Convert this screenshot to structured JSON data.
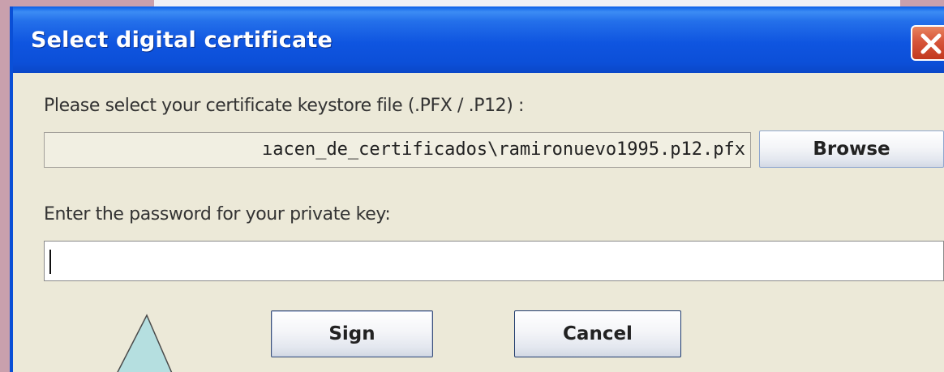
{
  "window": {
    "title": "Select digital certificate",
    "close_icon": "close-icon"
  },
  "form": {
    "file_label": "Please select your certificate keystore file (.PFX / .P12) :",
    "file_path_value": "ıacen_de_certificados\\ramironuevo1995.p12.pfx",
    "browse_label": "Browse",
    "password_label": "Enter the password for your private key:",
    "password_value": ""
  },
  "actions": {
    "sign_label": "Sign",
    "cancel_label": "Cancel"
  },
  "colors": {
    "titlebar": "#0c4fd8",
    "dialog_bg": "#ece9d8",
    "close_button": "#d7553a",
    "callout": "#b5dfe0"
  }
}
